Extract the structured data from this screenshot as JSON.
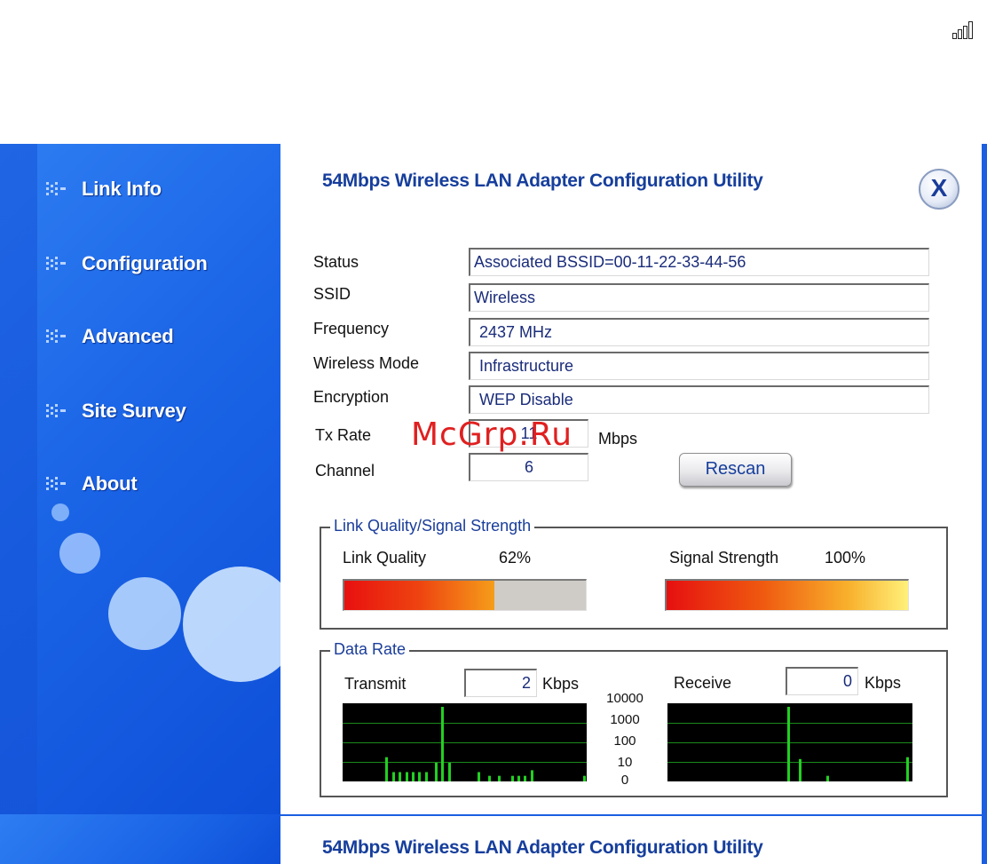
{
  "icons": {
    "signal": "signal-strength-icon",
    "nav_bullet": "dotted-bullet-icon",
    "close": "close-x-icon"
  },
  "sidebar": {
    "items": [
      {
        "label": "Link Info"
      },
      {
        "label": "Configuration"
      },
      {
        "label": "Advanced"
      },
      {
        "label": "Site Survey"
      },
      {
        "label": "About"
      }
    ]
  },
  "header": {
    "title": "54Mbps Wireless LAN Adapter Configuration Utility",
    "close_label": "X"
  },
  "info": {
    "status_label": "Status",
    "status_value": "Associated BSSID=00-11-22-33-44-56",
    "ssid_label": "SSID",
    "ssid_value": "Wireless",
    "frequency_label": "Frequency",
    "frequency_value": "2437 MHz",
    "mode_label": "Wireless Mode",
    "mode_value": "Infrastructure",
    "encryption_label": "Encryption",
    "encryption_value": "WEP Disable",
    "txrate_label": "Tx Rate",
    "txrate_value": "11",
    "txrate_unit": "Mbps",
    "channel_label": "Channel",
    "channel_value": "6",
    "rescan_label": "Rescan"
  },
  "link_quality": {
    "group_title": "Link Quality/Signal Strength",
    "quality_label": "Link Quality",
    "quality_value": "62%",
    "quality_fraction": 0.62,
    "signal_label": "Signal Strength",
    "signal_value": "100%",
    "signal_fraction": 1.0
  },
  "data_rate": {
    "group_title": "Data Rate",
    "transmit_label": "Transmit",
    "transmit_value": "2",
    "transmit_unit": "Kbps",
    "receive_label": "Receive",
    "receive_value": "0",
    "receive_unit": "Kbps",
    "scale_labels": [
      "10000",
      "1000",
      "100",
      "10",
      "0"
    ],
    "transmit_history": [
      0,
      0,
      0,
      0,
      0,
      0,
      0,
      0,
      0,
      0,
      0,
      0,
      0,
      1.3,
      0,
      0.5,
      0,
      0.5,
      0,
      0.5,
      0,
      0.5,
      0,
      0.5,
      0,
      0.5,
      0,
      0,
      1.0,
      0,
      4.0,
      0,
      1.0,
      0,
      0,
      0,
      0,
      0,
      0,
      0,
      0,
      0.5,
      0,
      0,
      0.3,
      0,
      0,
      0.3,
      0,
      0,
      0,
      0.3,
      0,
      0.3,
      0,
      0.3,
      0,
      0.6,
      0,
      0,
      0,
      0,
      0,
      0,
      0,
      0,
      0,
      0,
      0,
      0,
      0,
      0,
      0,
      0.3
    ],
    "receive_history": [
      0,
      0,
      0,
      0,
      0,
      0,
      0,
      0,
      0,
      0,
      0,
      0,
      0,
      0,
      0,
      0,
      0,
      0,
      0,
      0,
      0,
      0,
      0,
      0,
      0,
      0,
      0,
      0,
      0,
      0,
      0,
      0,
      0,
      0,
      0,
      0,
      0,
      0,
      0,
      4.0,
      0,
      0,
      0,
      1.2,
      0,
      0,
      0,
      0,
      0,
      0,
      0,
      0,
      0.3,
      0,
      0,
      0,
      0,
      0,
      0,
      0,
      0,
      0,
      0,
      0,
      0,
      0,
      0,
      0,
      0,
      0,
      0,
      0,
      0,
      0,
      0,
      0,
      0,
      0,
      1.3,
      0
    ]
  },
  "watermark": "McGrp.Ru",
  "window2": {
    "title": "54Mbps Wireless LAN Adapter Configuration Utility"
  }
}
